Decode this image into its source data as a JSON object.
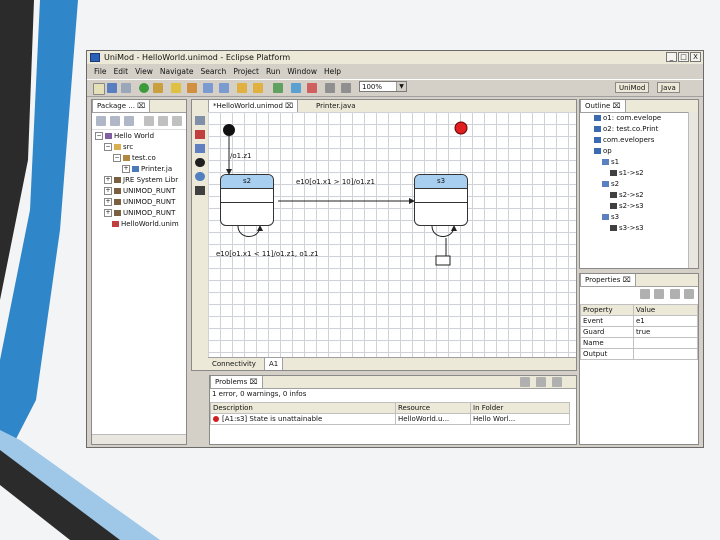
{
  "window": {
    "title": "UniMod - HelloWorld.unimod - Eclipse Platform",
    "controls": [
      "_",
      "□",
      "X"
    ]
  },
  "menu": [
    "File",
    "Edit",
    "View",
    "Navigate",
    "Search",
    "Project",
    "Run",
    "Window",
    "Help"
  ],
  "toolbar": {
    "zoom": "100%",
    "perspectives": [
      "UniMod",
      "Java"
    ]
  },
  "navigator": {
    "tab": "Package ... ⌧",
    "tree": [
      {
        "label": "Hello World",
        "indent": 0,
        "exp": "−",
        "icon": "project"
      },
      {
        "label": "src",
        "indent": 1,
        "exp": "−",
        "icon": "folder"
      },
      {
        "label": "test.co",
        "indent": 2,
        "exp": "−",
        "icon": "package"
      },
      {
        "label": "Printer.ja",
        "indent": 3,
        "exp": "+",
        "icon": "java"
      },
      {
        "label": "JRE System Libr",
        "indent": 1,
        "exp": "+",
        "icon": "lib"
      },
      {
        "label": "UNIMOD_RUNT",
        "indent": 1,
        "exp": "+",
        "icon": "lib"
      },
      {
        "label": "UNIMOD_RUNT",
        "indent": 1,
        "exp": "+",
        "icon": "lib"
      },
      {
        "label": "UNIMOD_RUNT",
        "indent": 1,
        "exp": "+",
        "icon": "lib"
      },
      {
        "label": "HelloWorld.unim",
        "indent": 1,
        "exp": "",
        "icon": "model"
      }
    ]
  },
  "editor": {
    "tabs": [
      "*HelloWorld.unimod ⌧",
      "Printer.java"
    ],
    "states": [
      "s2",
      "s3"
    ],
    "transitions": {
      "init": "/o1.z1",
      "main": "e10[o1.x1 > 10]/o1.z1",
      "self": "e10[o1.x1 < 11]/o1.z1, o1.z1"
    },
    "bottom_tabs": [
      "Connectivity",
      "A1"
    ]
  },
  "outline": {
    "tab": "Outline ⌧",
    "items": [
      {
        "label": "o1: com.evelope",
        "indent": 0
      },
      {
        "label": "o2: test.co.Print",
        "indent": 0
      },
      {
        "label": "com.evelopers",
        "indent": 0
      },
      {
        "label": "op",
        "indent": 0
      },
      {
        "label": "s1",
        "indent": 1
      },
      {
        "label": "s1->s2",
        "indent": 2
      },
      {
        "label": "s2",
        "indent": 1
      },
      {
        "label": "s2->s2",
        "indent": 2
      },
      {
        "label": "s2->s3",
        "indent": 2
      },
      {
        "label": "s3",
        "indent": 1
      },
      {
        "label": "s3->s3",
        "indent": 2
      }
    ]
  },
  "properties": {
    "tab": "Properties ⌧",
    "headers": [
      "Property",
      "Value"
    ],
    "rows": [
      [
        "Event",
        "e1"
      ],
      [
        "Guard",
        "true"
      ],
      [
        "Name",
        ""
      ],
      [
        "Output",
        ""
      ]
    ]
  },
  "problems": {
    "tab": "Problems ⌧",
    "summary": "1 error, 0 warnings, 0 infos",
    "headers": [
      "Description",
      "Resource",
      "In Folder"
    ],
    "rows": [
      [
        "[A1:s3] State is unattainable",
        "HelloWorld.u...",
        "Hello Worl..."
      ]
    ]
  },
  "colors": {
    "state_header": "#a9cff0",
    "grid": "#cfd3d8",
    "final_state": "#e02020",
    "band_dark": "#2b2b2b",
    "band_blue": "#2f86c8"
  }
}
